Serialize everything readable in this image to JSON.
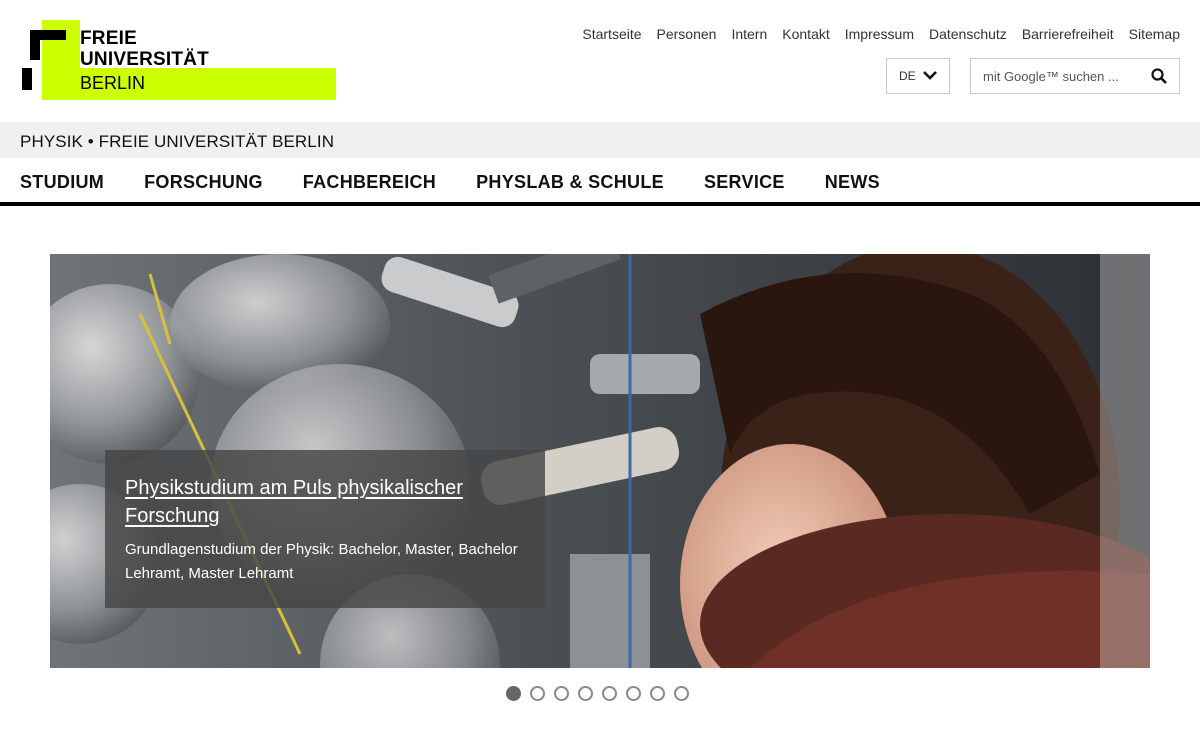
{
  "logo": {
    "line1": "FREIE",
    "line2": "UNIVERSITÄT",
    "line3": "BERLIN",
    "accent_color": "#ccff00"
  },
  "service_nav": [
    "Startseite",
    "Personen",
    "Intern",
    "Kontakt",
    "Impressum",
    "Datenschutz",
    "Barrierefreiheit",
    "Sitemap"
  ],
  "language": {
    "selected": "DE",
    "icon": "chevron-down-icon"
  },
  "search": {
    "placeholder": "mit Google™ suchen ...",
    "icon": "search-icon"
  },
  "site_title": "PHYSIK • FREIE UNIVERSITÄT BERLIN",
  "main_nav": [
    "STUDIUM",
    "FORSCHUNG",
    "FACHBEREICH",
    "PHYSLAB & SCHULE",
    "SERVICE",
    "NEWS"
  ],
  "hero": {
    "title": "Physikstudium am Puls physikalischer Forschung",
    "text": "Grundlagenstudium der Physik: Bachelor, Master, Bachelor Lehramt, Master Lehramt"
  },
  "carousel": {
    "total": 8,
    "active": 1
  }
}
